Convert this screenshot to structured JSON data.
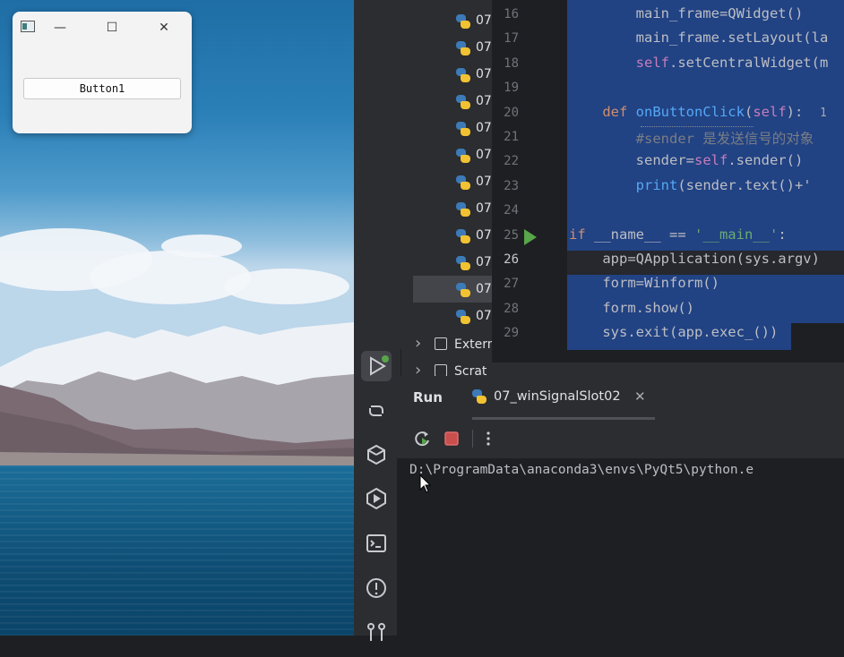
{
  "qt_window": {
    "button_label": "Button1",
    "controls": {
      "minimize": "—",
      "maximize": "☐",
      "close": "✕"
    }
  },
  "project_tree": {
    "files": [
      "07",
      "07",
      "07",
      "07",
      "07",
      "07",
      "07",
      "07",
      "07",
      "07",
      "07",
      "07"
    ],
    "external": "Extern",
    "scratches": "Scrat"
  },
  "editor": {
    "line_numbers": [
      "16",
      "17",
      "18",
      "19",
      "20",
      "21",
      "22",
      "23",
      "24",
      "25",
      "26",
      "27",
      "28",
      "29"
    ],
    "lines": [
      {
        "parts": [
          {
            "t": "        main_frame=QWidget()",
            "c": ""
          }
        ]
      },
      {
        "parts": [
          {
            "t": "        main_frame.setLayout(la",
            "c": ""
          }
        ]
      },
      {
        "parts": [
          {
            "t": "        ",
            "c": ""
          },
          {
            "t": "self",
            "c": "self"
          },
          {
            "t": ".setCentralWidget(m",
            "c": ""
          }
        ]
      },
      {
        "parts": [
          {
            "t": "",
            "c": ""
          }
        ]
      },
      {
        "parts": [
          {
            "t": "    ",
            "c": ""
          },
          {
            "t": "def ",
            "c": "kw"
          },
          {
            "t": "onButtonClick",
            "c": "fn"
          },
          {
            "t": "(",
            "c": ""
          },
          {
            "t": "self",
            "c": "self"
          },
          {
            "t": "):  ",
            "c": ""
          },
          {
            "t": "1",
            "c": "hint"
          }
        ]
      },
      {
        "parts": [
          {
            "t": "        #sender 是发送信号的对象",
            "c": "cm"
          }
        ]
      },
      {
        "parts": [
          {
            "t": "        sender=",
            "c": ""
          },
          {
            "t": "self",
            "c": "self"
          },
          {
            "t": ".sender()",
            "c": ""
          }
        ]
      },
      {
        "parts": [
          {
            "t": "        ",
            "c": ""
          },
          {
            "t": "print",
            "c": "fn"
          },
          {
            "t": "(sender.text()+'",
            "c": ""
          }
        ]
      },
      {
        "parts": [
          {
            "t": "",
            "c": ""
          }
        ]
      },
      {
        "parts": [
          {
            "t": "if ",
            "c": "kw"
          },
          {
            "t": "__name__ == ",
            "c": ""
          },
          {
            "t": "'__main__'",
            "c": "str"
          },
          {
            "t": ":",
            "c": ""
          }
        ]
      },
      {
        "parts": [
          {
            "t": "    app=QApplication(sys.argv)",
            "c": ""
          }
        ]
      },
      {
        "parts": [
          {
            "t": "    form=Winform()",
            "c": ""
          }
        ]
      },
      {
        "parts": [
          {
            "t": "    form.show()",
            "c": ""
          }
        ]
      },
      {
        "parts": [
          {
            "t": "    sys.exit(app.exec_())",
            "c": ""
          }
        ]
      }
    ]
  },
  "run_panel": {
    "title": "Run",
    "tab_label": "07_winSignalSlot02",
    "tab_close": "✕",
    "console_output": "D:\\ProgramData\\anaconda3\\envs\\PyQt5\\python.e"
  },
  "colors": {
    "selection": "#214283",
    "ide_bg": "#1e1f22",
    "panel_bg": "#2b2d30",
    "run_green": "#57a64a",
    "stop_red": "#db5c5c"
  }
}
